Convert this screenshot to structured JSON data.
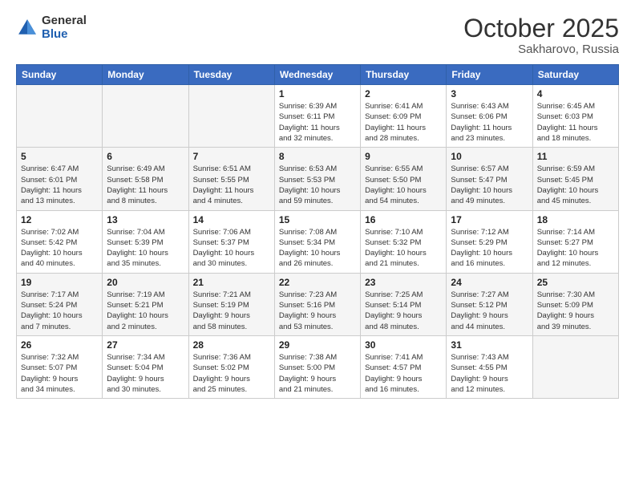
{
  "header": {
    "logo_general": "General",
    "logo_blue": "Blue",
    "month": "October 2025",
    "location": "Sakharovo, Russia"
  },
  "days_of_week": [
    "Sunday",
    "Monday",
    "Tuesday",
    "Wednesday",
    "Thursday",
    "Friday",
    "Saturday"
  ],
  "weeks": [
    [
      {
        "day": "",
        "info": ""
      },
      {
        "day": "",
        "info": ""
      },
      {
        "day": "",
        "info": ""
      },
      {
        "day": "1",
        "info": "Sunrise: 6:39 AM\nSunset: 6:11 PM\nDaylight: 11 hours\nand 32 minutes."
      },
      {
        "day": "2",
        "info": "Sunrise: 6:41 AM\nSunset: 6:09 PM\nDaylight: 11 hours\nand 28 minutes."
      },
      {
        "day": "3",
        "info": "Sunrise: 6:43 AM\nSunset: 6:06 PM\nDaylight: 11 hours\nand 23 minutes."
      },
      {
        "day": "4",
        "info": "Sunrise: 6:45 AM\nSunset: 6:03 PM\nDaylight: 11 hours\nand 18 minutes."
      }
    ],
    [
      {
        "day": "5",
        "info": "Sunrise: 6:47 AM\nSunset: 6:01 PM\nDaylight: 11 hours\nand 13 minutes."
      },
      {
        "day": "6",
        "info": "Sunrise: 6:49 AM\nSunset: 5:58 PM\nDaylight: 11 hours\nand 8 minutes."
      },
      {
        "day": "7",
        "info": "Sunrise: 6:51 AM\nSunset: 5:55 PM\nDaylight: 11 hours\nand 4 minutes."
      },
      {
        "day": "8",
        "info": "Sunrise: 6:53 AM\nSunset: 5:53 PM\nDaylight: 10 hours\nand 59 minutes."
      },
      {
        "day": "9",
        "info": "Sunrise: 6:55 AM\nSunset: 5:50 PM\nDaylight: 10 hours\nand 54 minutes."
      },
      {
        "day": "10",
        "info": "Sunrise: 6:57 AM\nSunset: 5:47 PM\nDaylight: 10 hours\nand 49 minutes."
      },
      {
        "day": "11",
        "info": "Sunrise: 6:59 AM\nSunset: 5:45 PM\nDaylight: 10 hours\nand 45 minutes."
      }
    ],
    [
      {
        "day": "12",
        "info": "Sunrise: 7:02 AM\nSunset: 5:42 PM\nDaylight: 10 hours\nand 40 minutes."
      },
      {
        "day": "13",
        "info": "Sunrise: 7:04 AM\nSunset: 5:39 PM\nDaylight: 10 hours\nand 35 minutes."
      },
      {
        "day": "14",
        "info": "Sunrise: 7:06 AM\nSunset: 5:37 PM\nDaylight: 10 hours\nand 30 minutes."
      },
      {
        "day": "15",
        "info": "Sunrise: 7:08 AM\nSunset: 5:34 PM\nDaylight: 10 hours\nand 26 minutes."
      },
      {
        "day": "16",
        "info": "Sunrise: 7:10 AM\nSunset: 5:32 PM\nDaylight: 10 hours\nand 21 minutes."
      },
      {
        "day": "17",
        "info": "Sunrise: 7:12 AM\nSunset: 5:29 PM\nDaylight: 10 hours\nand 16 minutes."
      },
      {
        "day": "18",
        "info": "Sunrise: 7:14 AM\nSunset: 5:27 PM\nDaylight: 10 hours\nand 12 minutes."
      }
    ],
    [
      {
        "day": "19",
        "info": "Sunrise: 7:17 AM\nSunset: 5:24 PM\nDaylight: 10 hours\nand 7 minutes."
      },
      {
        "day": "20",
        "info": "Sunrise: 7:19 AM\nSunset: 5:21 PM\nDaylight: 10 hours\nand 2 minutes."
      },
      {
        "day": "21",
        "info": "Sunrise: 7:21 AM\nSunset: 5:19 PM\nDaylight: 9 hours\nand 58 minutes."
      },
      {
        "day": "22",
        "info": "Sunrise: 7:23 AM\nSunset: 5:16 PM\nDaylight: 9 hours\nand 53 minutes."
      },
      {
        "day": "23",
        "info": "Sunrise: 7:25 AM\nSunset: 5:14 PM\nDaylight: 9 hours\nand 48 minutes."
      },
      {
        "day": "24",
        "info": "Sunrise: 7:27 AM\nSunset: 5:12 PM\nDaylight: 9 hours\nand 44 minutes."
      },
      {
        "day": "25",
        "info": "Sunrise: 7:30 AM\nSunset: 5:09 PM\nDaylight: 9 hours\nand 39 minutes."
      }
    ],
    [
      {
        "day": "26",
        "info": "Sunrise: 7:32 AM\nSunset: 5:07 PM\nDaylight: 9 hours\nand 34 minutes."
      },
      {
        "day": "27",
        "info": "Sunrise: 7:34 AM\nSunset: 5:04 PM\nDaylight: 9 hours\nand 30 minutes."
      },
      {
        "day": "28",
        "info": "Sunrise: 7:36 AM\nSunset: 5:02 PM\nDaylight: 9 hours\nand 25 minutes."
      },
      {
        "day": "29",
        "info": "Sunrise: 7:38 AM\nSunset: 5:00 PM\nDaylight: 9 hours\nand 21 minutes."
      },
      {
        "day": "30",
        "info": "Sunrise: 7:41 AM\nSunset: 4:57 PM\nDaylight: 9 hours\nand 16 minutes."
      },
      {
        "day": "31",
        "info": "Sunrise: 7:43 AM\nSunset: 4:55 PM\nDaylight: 9 hours\nand 12 minutes."
      },
      {
        "day": "",
        "info": ""
      }
    ]
  ]
}
